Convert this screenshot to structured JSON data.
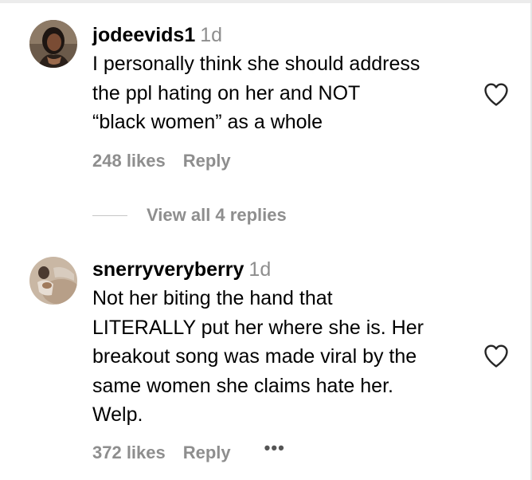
{
  "comments": [
    {
      "username": "jodeevids1",
      "time": "1d",
      "lines": [
        "I personally think she should address",
        "the ppl hating on her and NOT",
        "“black women” as a whole"
      ],
      "likes": "248 likes",
      "reply_label": "Reply",
      "like_icon": "heart-outline-icon"
    },
    {
      "username": "snerryveryberry",
      "time": "1d",
      "lines": [
        "Not her biting the hand that",
        "LITERALLY put her where she is. Her",
        "breakout song was made viral by the",
        "same women she claims hate her.",
        "Welp."
      ],
      "likes": "372 likes",
      "reply_label": "Reply",
      "more_label": "•••",
      "like_icon": "heart-outline-icon"
    }
  ],
  "view_replies": {
    "label": "View all 4 replies"
  },
  "colors": {
    "muted": "#8e8e8e",
    "text": "#000000",
    "divider": "#c7c7c7"
  }
}
